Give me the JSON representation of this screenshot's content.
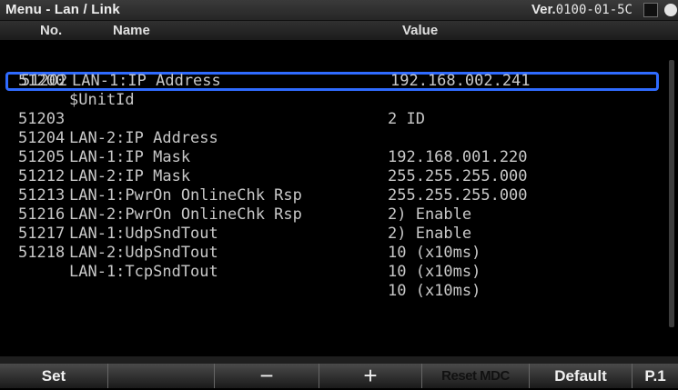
{
  "header": {
    "title": "Menu - Lan / Link",
    "version_label": "Ver.",
    "version_code": "0100-01-5C"
  },
  "columns": {
    "no": "No.",
    "name": "Name",
    "value": "Value"
  },
  "rows": [
    {
      "no": "51200",
      "name": "$UnitId",
      "value": "2 ID",
      "selected": false
    },
    {
      "no": "51202",
      "name": "LAN-1:IP Address",
      "value": "192.168.002.241",
      "selected": true
    },
    {
      "no": "51203",
      "name": "LAN-2:IP Address",
      "value": "192.168.001.220",
      "selected": false
    },
    {
      "no": "51204",
      "name": "LAN-1:IP Mask",
      "value": "255.255.255.000",
      "selected": false
    },
    {
      "no": "51205",
      "name": "LAN-2:IP Mask",
      "value": "255.255.255.000",
      "selected": false
    },
    {
      "no": "51212",
      "name": "LAN-1:PwrOn OnlineChk Rsp",
      "value": "2) Enable",
      "selected": false
    },
    {
      "no": "51213",
      "name": "LAN-2:PwrOn OnlineChk Rsp",
      "value": "2) Enable",
      "selected": false
    },
    {
      "no": "51216",
      "name": "LAN-1:UdpSndTout",
      "value": "10 (x10ms)",
      "selected": false
    },
    {
      "no": "51217",
      "name": "LAN-2:UdpSndTout",
      "value": "10 (x10ms)",
      "selected": false
    },
    {
      "no": "51218",
      "name": "LAN-1:TcpSndTout",
      "value": "10 (x10ms)",
      "selected": false
    }
  ],
  "softkeys": {
    "set": "Set",
    "blank": "",
    "minus": "−",
    "plus": "+",
    "reset_mdc": "Reset MDC",
    "default": "Default",
    "page": "P.1"
  },
  "colors": {
    "selection_border": "#2f6bff",
    "text": "#c8c8c8",
    "background": "#000000"
  }
}
